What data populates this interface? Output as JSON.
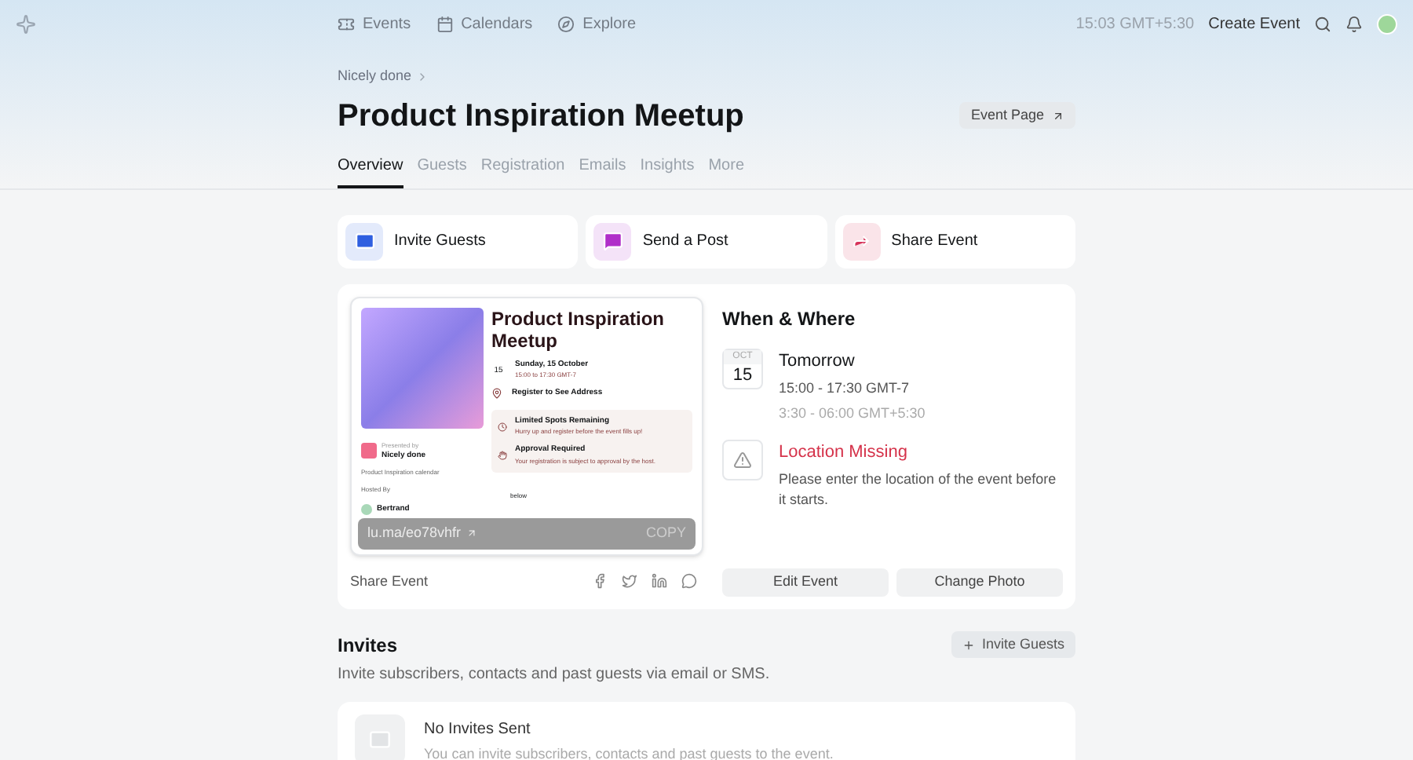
{
  "nav": {
    "items": [
      {
        "label": "Events"
      },
      {
        "label": "Calendars"
      },
      {
        "label": "Explore"
      }
    ],
    "time": "15:03 GMT+5:30",
    "create": "Create Event"
  },
  "breadcrumb": "Nicely done",
  "title": "Product Inspiration Meetup",
  "event_page": "Event Page",
  "tabs": [
    {
      "label": "Overview",
      "selected": true
    },
    {
      "label": "Guests",
      "selected": false
    },
    {
      "label": "Registration",
      "selected": false
    },
    {
      "label": "Emails",
      "selected": false
    },
    {
      "label": "Insights",
      "selected": false
    },
    {
      "label": "More",
      "selected": false
    }
  ],
  "actions": [
    {
      "label": "Invite Guests",
      "color": "#2f5fe0"
    },
    {
      "label": "Send a Post",
      "color": "#b02fc9"
    },
    {
      "label": "Share Event",
      "color": "#d6335a"
    }
  ],
  "preview": {
    "title": "Product Inspiration Meetup",
    "day": "15",
    "date": "Sunday, 15 October",
    "time": "15:00 to 17:30 GMT-7",
    "address": "Register to See Address",
    "presented_label": "Presented by",
    "presenter": "Nicely done",
    "calendar": "Product Inspiration calendar",
    "hosted_by": "Hosted By",
    "host": "Bertrand",
    "notices": [
      {
        "title": "Limited Spots Remaining",
        "text": "Hurry up and register before the event fills up!"
      },
      {
        "title": "Approval Required",
        "text": "Your registration is subject to approval by the host."
      }
    ],
    "below": "below",
    "url": "lu.ma/eo78vhfr",
    "copy": "COPY"
  },
  "share_label": "Share Event",
  "when": {
    "heading": "When & Where",
    "month": "OCT",
    "day": "15",
    "day_label": "Tomorrow",
    "time": "15:00 - 17:30 GMT-7",
    "local_time": "3:30 - 06:00 GMT+5:30",
    "location_title": "Location Missing",
    "location_text": "Please enter the location of the event before it starts."
  },
  "buttons": [
    "Edit Event",
    "Change Photo"
  ],
  "invites": {
    "heading": "Invites",
    "button": "Invite Guests",
    "subtitle": "Invite subscribers, contacts and past guests via email or SMS.",
    "empty_title": "No Invites Sent",
    "empty_text": "You can invite subscribers, contacts and past guests to the event."
  }
}
